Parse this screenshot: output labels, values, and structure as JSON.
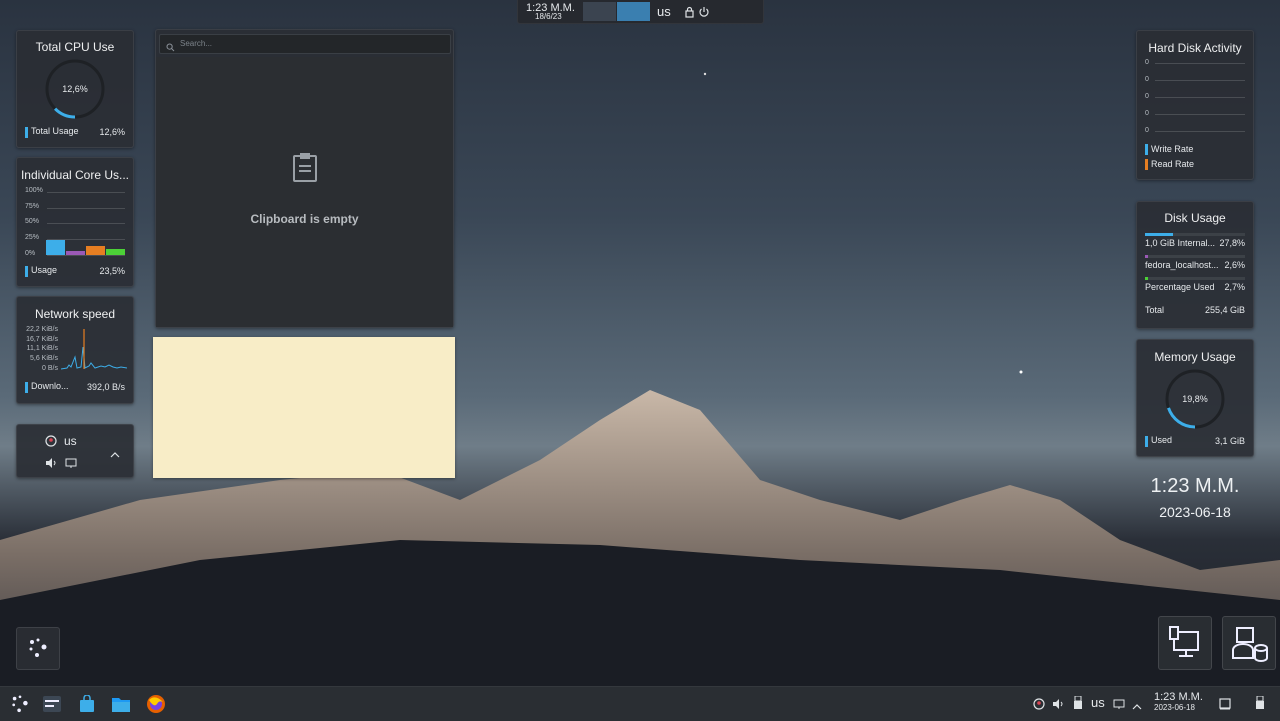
{
  "top_panel": {
    "time": "1:23 M.M.",
    "date": "18/6/23",
    "keyboard_layout": "us"
  },
  "cpu_widget": {
    "title": "Total CPU Use",
    "center_value": "12,6%",
    "percent": 12.6,
    "legend_label": "Total Usage",
    "legend_value": "12,6%",
    "accent": "#3daee9"
  },
  "core_widget": {
    "title": "Individual Core Us...",
    "y_ticks": [
      "100%",
      "75%",
      "50%",
      "25%",
      "0%"
    ],
    "bars": [
      {
        "value": 25,
        "color": "#3daee9"
      },
      {
        "value": 6,
        "color": "#9b59b6"
      },
      {
        "value": 15,
        "color": "#e67e22"
      },
      {
        "value": 10,
        "color": "#4cd137"
      }
    ],
    "legend_label": "Usage",
    "legend_value": "23,5%"
  },
  "network_widget": {
    "title": "Network speed",
    "y_ticks": [
      "22,2 KiB/s",
      "16,7 KiB/s",
      "11,1 KiB/s",
      "5,6 KiB/s",
      "0 B/s"
    ],
    "legend_label": "Downlo...",
    "legend_value": "392,0 B/s"
  },
  "tray_widget": {
    "layout": "us"
  },
  "clipboard": {
    "search_placeholder": "Search...",
    "empty_text": "Clipboard is empty"
  },
  "disk_activity": {
    "title": "Hard Disk Activity",
    "y_ticks": [
      "0",
      "0",
      "0",
      "0",
      "0"
    ],
    "legend": [
      {
        "label": "Write Rate",
        "color": "#3daee9"
      },
      {
        "label": "Read Rate",
        "color": "#e67e22"
      }
    ]
  },
  "disk_usage": {
    "title": "Disk Usage",
    "rows": [
      {
        "label": "1,0 GiB Internal...",
        "value": "27,8%",
        "percent": 27.8,
        "color": "#3daee9"
      },
      {
        "label": "fedora_localhost...",
        "value": "2,6%",
        "percent": 2.6,
        "color": "#9b59b6"
      },
      {
        "label": "Percentage Used",
        "value": "2,7%",
        "percent": 2.7,
        "color": "#4cd137"
      }
    ],
    "total_label": "Total",
    "total_value": "255,4 GiB"
  },
  "memory_widget": {
    "title": "Memory Usage",
    "center_value": "19,8%",
    "percent": 19.8,
    "legend_label": "Used",
    "legend_value": "3,1 GiB"
  },
  "desktop_clock": {
    "time": "1:23 M.M.",
    "date": "2023-06-18"
  },
  "taskbar": {
    "layout": "us",
    "time": "1:23 M.M.",
    "date": "2023-06-18"
  }
}
